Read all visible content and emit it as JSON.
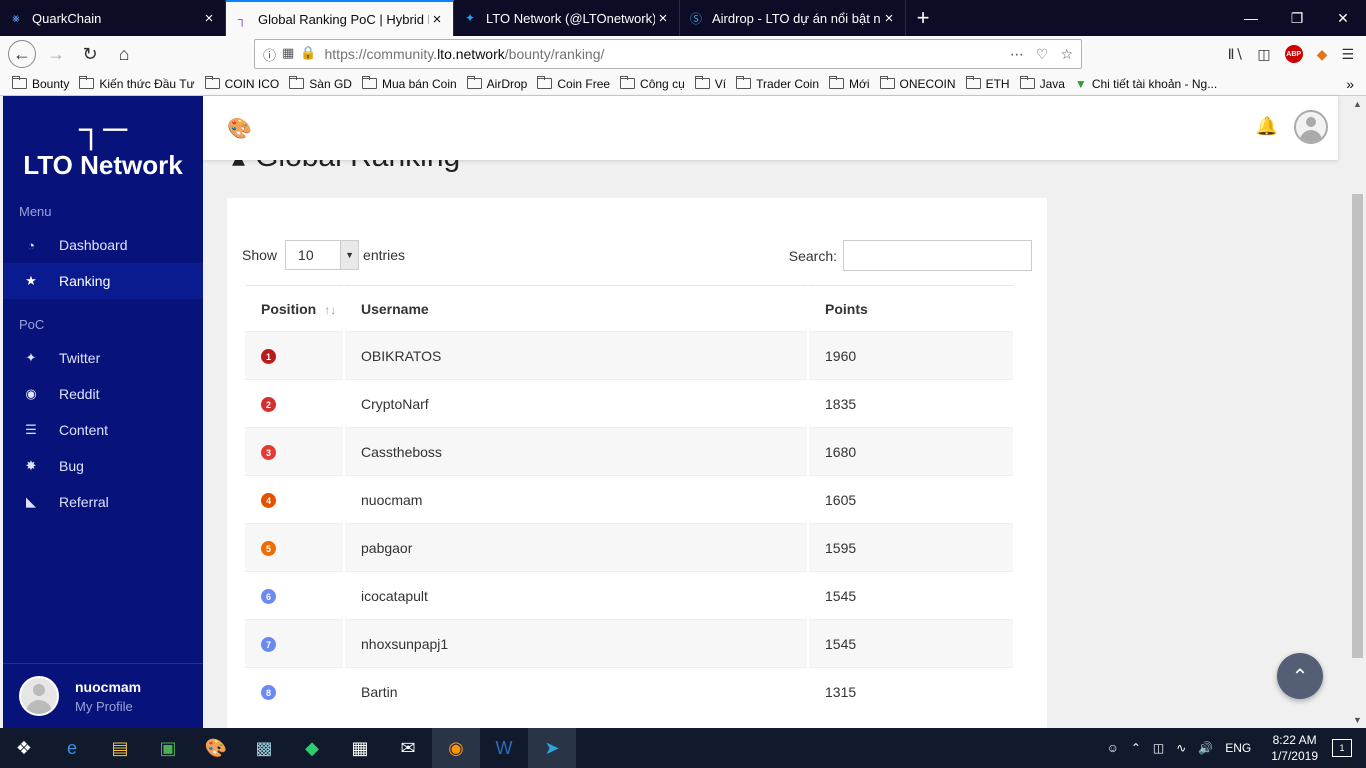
{
  "browser": {
    "tabs": [
      {
        "title": "QuarkChain",
        "icon": "quarkchain-icon",
        "active": false
      },
      {
        "title": "Global Ranking PoC | Hybrid Bl",
        "icon": "lto-icon",
        "active": true
      },
      {
        "title": "LTO Network (@LTOnetwork) |",
        "icon": "twitter-icon",
        "active": false
      },
      {
        "title": "Airdrop - LTO dự án nổi bật nhất",
        "icon": "steemit-icon",
        "active": false
      }
    ],
    "url_prefix": "https://community.",
    "url_domain": "lto.network",
    "url_path": "/bounty/ranking/",
    "bookmarks": [
      "Bounty",
      "Kiến thức Đầu Tư",
      "COIN ICO",
      "Sàn GD",
      "Mua bán Coin",
      "AirDrop",
      "Coin Free",
      "Công cụ",
      "Ví",
      "Trader Coin",
      "Mới",
      "ONECOIN",
      "ETH",
      "Java",
      "Chi tiết tài khoản - Ng..."
    ]
  },
  "sidebar": {
    "logo_mark": "┐─",
    "logo_text": "LTO Network",
    "sections": [
      {
        "label": "Menu",
        "items": [
          {
            "label": "Dashboard",
            "icon": "dashboard-icon",
            "glyph": "◔",
            "active": false
          },
          {
            "label": "Ranking",
            "icon": "trophy-icon",
            "glyph": "★",
            "active": true
          }
        ]
      },
      {
        "label": "PoC",
        "items": [
          {
            "label": "Twitter",
            "icon": "twitter-icon",
            "glyph": "✦",
            "active": false
          },
          {
            "label": "Reddit",
            "icon": "reddit-icon",
            "glyph": "◉",
            "active": false
          },
          {
            "label": "Content",
            "icon": "content-icon",
            "glyph": "☰",
            "active": false
          },
          {
            "label": "Bug",
            "icon": "bug-icon",
            "glyph": "✸",
            "active": false
          },
          {
            "label": "Referral",
            "icon": "rss-icon",
            "glyph": "◣",
            "active": false
          }
        ]
      }
    ],
    "user": {
      "name": "nuocmam",
      "profile_link": "My Profile"
    }
  },
  "page": {
    "title": "Global Ranking",
    "show_label": "Show",
    "entries_value": "10",
    "entries_label": "entries",
    "search_label": "Search:",
    "search_value": ""
  },
  "table": {
    "columns": [
      "Position",
      "Username",
      "Points"
    ],
    "rows": [
      {
        "position": "1",
        "username": "OBIKRATOS",
        "points": "1960",
        "color": "#b71c1c"
      },
      {
        "position": "2",
        "username": "CryptoNarf",
        "points": "1835",
        "color": "#d32f2f"
      },
      {
        "position": "3",
        "username": "Casstheboss",
        "points": "1680",
        "color": "#e53935"
      },
      {
        "position": "4",
        "username": "nuocmam",
        "points": "1605",
        "color": "#e65100"
      },
      {
        "position": "5",
        "username": "pabgaor",
        "points": "1595",
        "color": "#ef6c00"
      },
      {
        "position": "6",
        "username": "icocatapult",
        "points": "1545",
        "color": "#6b8af0"
      },
      {
        "position": "7",
        "username": "nhoxsunpapj1",
        "points": "1545",
        "color": "#6b8af0"
      },
      {
        "position": "8",
        "username": "Bartin",
        "points": "1315",
        "color": "#6b8af0"
      }
    ]
  },
  "taskbar": {
    "language": "ENG",
    "time": "8:22 AM",
    "date": "1/7/2019",
    "notifications": "1"
  }
}
